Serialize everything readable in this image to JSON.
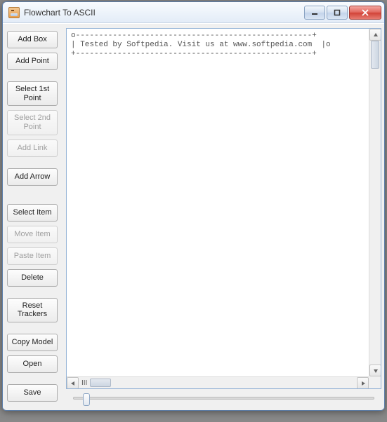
{
  "window": {
    "title": "Flowchart To ASCII"
  },
  "sidebar": {
    "add_box": "Add Box",
    "add_point": "Add Point",
    "select_1st_point": "Select 1st Point",
    "select_2nd_point": "Select 2nd Point",
    "add_link": "Add Link",
    "add_arrow": "Add Arrow",
    "select_item": "Select Item",
    "move_item": "Move Item",
    "paste_item": "Paste Item",
    "delete": "Delete",
    "reset_trackers": "Reset Trackers",
    "copy_model": "Copy Model",
    "open": "Open",
    "save": "Save"
  },
  "canvas": {
    "line1": "o---------------------------------------------------+",
    "line2": "| Tested by Softpedia. Visit us at www.softpedia.com  |o",
    "line3": "+---------------------------------------------------+"
  },
  "hscroll": {
    "label": "III"
  }
}
